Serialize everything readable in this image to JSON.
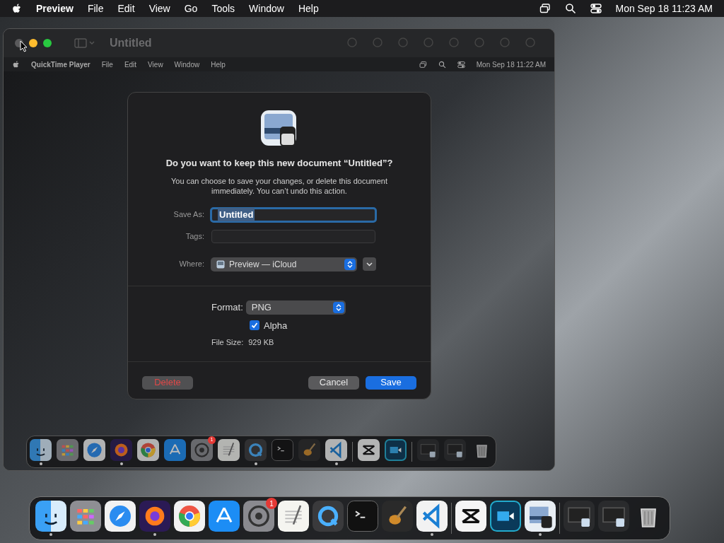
{
  "menu_bar": {
    "app": "Preview",
    "items": [
      "File",
      "Edit",
      "View",
      "Go",
      "Tools",
      "Window",
      "Help"
    ],
    "clock": "Mon Sep 18  11:23 AM"
  },
  "window": {
    "title": "Untitled",
    "inner_menu_bar": {
      "app": "QuickTime Player",
      "items": [
        "File",
        "Edit",
        "View",
        "Window",
        "Help"
      ],
      "clock": "Mon Sep 18  11:22 AM"
    },
    "dialog": {
      "title": "Do you want to keep this new document “Untitled”?",
      "message": "You can choose to save your changes, or delete this document immediately. You can’t undo this action.",
      "save_as": {
        "label": "Save As:",
        "value": "Untitled"
      },
      "tags": {
        "label": "Tags:"
      },
      "where": {
        "label": "Where:",
        "value": "Preview — iCloud"
      },
      "format": {
        "label": "Format:",
        "value": "PNG"
      },
      "alpha": {
        "label": "Alpha",
        "checked": true
      },
      "file_size": {
        "label": "File Size:",
        "value": "929 KB"
      },
      "buttons": [
        {
          "label": "Delete",
          "kind": "destructive",
          "disabled": true
        },
        {
          "label": "Cancel",
          "kind": "normal",
          "disabled": false
        },
        {
          "label": "Save",
          "kind": "default",
          "disabled": false
        }
      ]
    },
    "inner_dock": [
      {
        "kind": "finder",
        "running": true
      },
      {
        "kind": "launchpad",
        "running": false
      },
      {
        "kind": "safari",
        "running": false
      },
      {
        "kind": "firefox",
        "running": true
      },
      {
        "kind": "chrome",
        "running": false
      },
      {
        "kind": "appstore",
        "running": false
      },
      {
        "kind": "settings",
        "running": false,
        "badge": "1"
      },
      {
        "kind": "textedit",
        "running": false
      },
      {
        "kind": "quicktime",
        "running": true
      },
      {
        "kind": "terminal",
        "running": false
      },
      {
        "kind": "garageband",
        "running": false
      },
      {
        "kind": "vscode",
        "running": true
      },
      {
        "kind": "separator"
      },
      {
        "kind": "capcut",
        "running": false
      },
      {
        "kind": "recorder",
        "running": false
      },
      {
        "kind": "separator"
      },
      {
        "kind": "thumbnail",
        "running": false
      },
      {
        "kind": "thumbnail",
        "running": false
      },
      {
        "kind": "trash",
        "running": false
      }
    ]
  },
  "dock": [
    {
      "kind": "finder",
      "running": true
    },
    {
      "kind": "launchpad",
      "running": false
    },
    {
      "kind": "safari",
      "running": false
    },
    {
      "kind": "firefox",
      "running": true
    },
    {
      "kind": "chrome",
      "running": false
    },
    {
      "kind": "appstore",
      "running": false
    },
    {
      "kind": "settings",
      "running": false,
      "badge": "1"
    },
    {
      "kind": "textedit",
      "running": false
    },
    {
      "kind": "quicktime",
      "running": false
    },
    {
      "kind": "terminal",
      "running": false
    },
    {
      "kind": "garageband",
      "running": false
    },
    {
      "kind": "vscode",
      "running": true
    },
    {
      "kind": "separator"
    },
    {
      "kind": "capcut",
      "running": false
    },
    {
      "kind": "recorder",
      "running": false
    },
    {
      "kind": "preview",
      "running": true
    },
    {
      "kind": "separator"
    },
    {
      "kind": "thumbnail",
      "running": false
    },
    {
      "kind": "thumbnail",
      "running": false
    },
    {
      "kind": "trash",
      "running": false
    }
  ]
}
